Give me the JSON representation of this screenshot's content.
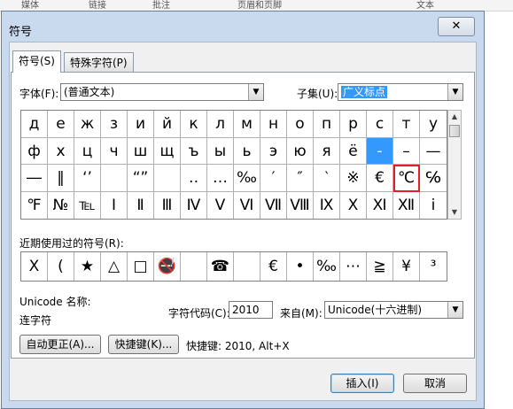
{
  "background_tabs": [
    "媒体",
    "链接",
    "批注",
    "页眉和页脚",
    "文本"
  ],
  "dialog": {
    "title": "符号",
    "close_glyph": "✕",
    "tabs": [
      {
        "label": "符号(S)",
        "active": true
      },
      {
        "label": "特殊字符(P)",
        "active": false
      }
    ],
    "font": {
      "label": "字体(F):",
      "value": "(普通文本)"
    },
    "subset": {
      "label": "子集(U):",
      "value": "广义标点"
    },
    "symbols": [
      [
        "д",
        "е",
        "ж",
        "з",
        "и",
        "й",
        "к",
        "л",
        "м",
        "н",
        "о",
        "п",
        "р",
        "с",
        "т",
        "у"
      ],
      [
        "ф",
        "х",
        "ц",
        "ч",
        "ш",
        "щ",
        "ъ",
        "ы",
        "ь",
        "э",
        "ю",
        "я",
        "ё",
        "‐",
        "–",
        "—"
      ],
      [
        "―",
        "‖",
        "‘’",
        "",
        "“”",
        "",
        "‥",
        "…",
        "‰",
        "′",
        "″",
        "‵",
        "※",
        "€",
        "℃",
        "℅"
      ],
      [
        "℉",
        "№",
        "℡",
        "Ⅰ",
        "Ⅱ",
        "Ⅲ",
        "Ⅳ",
        "Ⅴ",
        "Ⅵ",
        "Ⅶ",
        "Ⅷ",
        "Ⅸ",
        "Ⅹ",
        "Ⅺ",
        "Ⅻ",
        "ⅰ"
      ]
    ],
    "selected_symbol": "‐",
    "highlighted_symbol": "℃",
    "recent_label": "近期使用过的符号(R):",
    "recent": [
      "Ⅹ",
      "(",
      "★",
      "△",
      "□",
      "🚭",
      "",
      "☎",
      "",
      "€",
      "•",
      "‰",
      "⋯",
      "≧",
      "¥",
      "³"
    ],
    "unicode_name_label": "Unicode 名称:",
    "unicode_name": "连字符",
    "char_code_label": "字符代码(C):",
    "char_code": "2010",
    "from_label": "来自(M):",
    "from_value": "Unicode(十六进制)",
    "autocorrect_button": "自动更正(A)...",
    "shortcut_button": "快捷键(K)...",
    "shortcut_text": "快捷键: 2010, Alt+X",
    "insert_button": "插入(I)",
    "cancel_button": "取消"
  },
  "colors": {
    "selection": "#3399ff",
    "highlight_box": "#e21d2c",
    "title_bar": "#c9daee"
  }
}
